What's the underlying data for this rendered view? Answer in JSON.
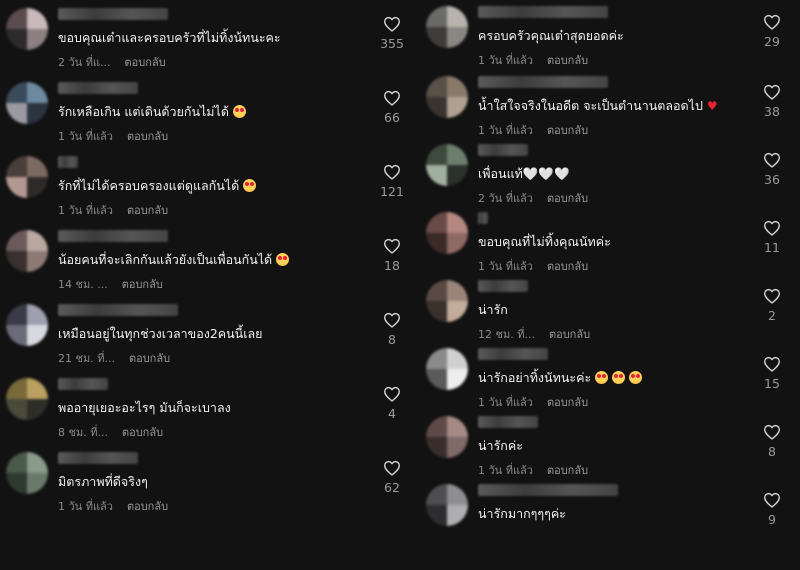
{
  "colors": {
    "background": "#121212",
    "text": "#f1f1f1",
    "muted": "#8a8a8a",
    "heart_outline": "#cfcfcf"
  },
  "icons": {
    "like": "heart-outline-icon"
  },
  "left_comments": [
    {
      "text": "ขอบคุณเต๋าและครอบครัวที่ไม่ทิ้งน้ทนะคะ",
      "time": "2 วัน ที่แ...",
      "reply": "ตอบกลับ",
      "likes": "355",
      "emoji": ""
    },
    {
      "text": "รักเหลือเกิน แต่เดินด้วยกันไม่ได้",
      "time": "1 วัน ที่แล้ว",
      "reply": "ตอบกลับ",
      "likes": "66",
      "emoji": "love"
    },
    {
      "text": "รักที่ไม่ได้ครอบครองแต่ดูแลกันได้",
      "time": "1 วัน ที่แล้ว",
      "reply": "ตอบกลับ",
      "likes": "121",
      "emoji": "love"
    },
    {
      "text": "น้อยคนที่จะเลิกกันแล้วยังเป็นเพื่อนกันได้",
      "time": "14 ชม. ...",
      "reply": "ตอบกลับ",
      "likes": "18",
      "emoji": "love"
    },
    {
      "text": "เหมือนอยู่ในทุกช่วงเวลาของ2คนนี้เลย",
      "time": "21 ชม. ที่...",
      "reply": "ตอบกลับ",
      "likes": "8",
      "emoji": ""
    },
    {
      "text": "พออายุเยอะอะไรๆ มันก็จะเบาลง",
      "time": "8 ชม. ที่...",
      "reply": "ตอบกลับ",
      "likes": "4",
      "emoji": ""
    },
    {
      "text": "มิตรภาพที่ดีจริงๆ",
      "time": "1 วัน ที่แล้ว",
      "reply": "ตอบกลับ",
      "likes": "62",
      "emoji": ""
    }
  ],
  "right_comments": [
    {
      "text": "ครอบครัวคุณเต๋าสุดยอดค่ะ",
      "time": "1 วัน ที่แล้ว",
      "reply": "ตอบกลับ",
      "likes": "29",
      "emoji": ""
    },
    {
      "text": "น้ำใสใจจริงในอดีต จะเป็นตำนานตลอดไป",
      "time": "1 วัน ที่แล้ว",
      "reply": "ตอบกลับ",
      "likes": "38",
      "emoji": "redheart"
    },
    {
      "text": "เพื่อนแท้🤍🤍🤍",
      "time": "2 วัน ที่แล้ว",
      "reply": "ตอบกลับ",
      "likes": "36",
      "emoji": ""
    },
    {
      "text": "ขอบคุณที่ไม่ทิ้งคุณนัทค่ะ",
      "time": "1 วัน ที่แล้ว",
      "reply": "ตอบกลับ",
      "likes": "11",
      "emoji": ""
    },
    {
      "text": "น่ารัก",
      "time": "12 ชม. ที่...",
      "reply": "ตอบกลับ",
      "likes": "2",
      "emoji": ""
    },
    {
      "text": "น่ารักอย่าทิ้งนัทนะค่ะ",
      "time": "1 วัน ที่แล้ว",
      "reply": "ตอบกลับ",
      "likes": "15",
      "emoji": "love3"
    },
    {
      "text": "น่ารักค่ะ",
      "time": "1 วัน ที่แล้ว",
      "reply": "ตอบกลับ",
      "likes": "8",
      "emoji": ""
    },
    {
      "text": "น่ารักมากๆๆๆค่ะ",
      "time": "",
      "reply": "",
      "likes": "9",
      "emoji": ""
    }
  ]
}
